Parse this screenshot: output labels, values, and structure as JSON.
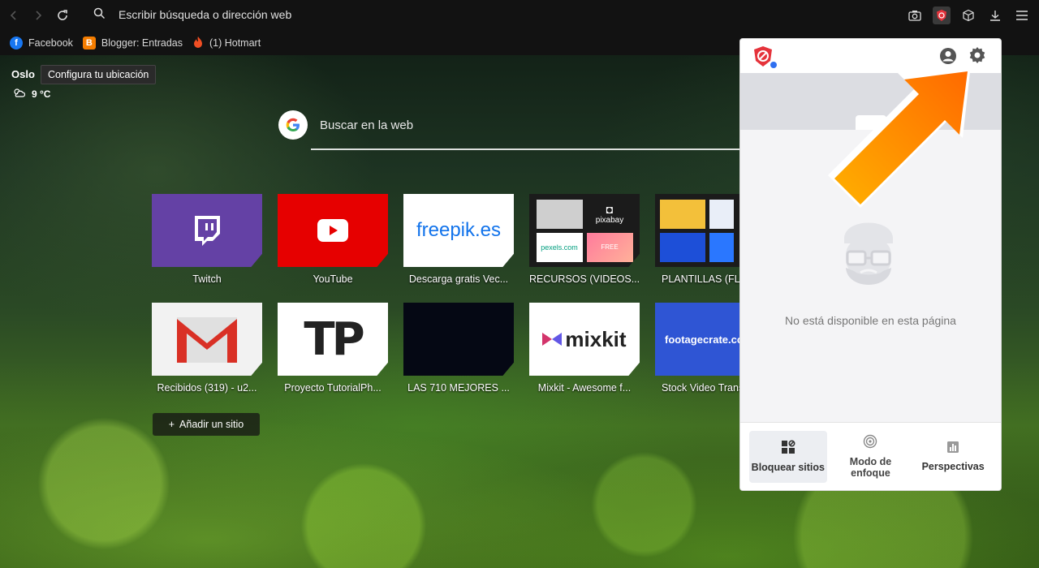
{
  "toolbar": {
    "address_placeholder": "Escribir búsqueda o dirección web",
    "icons": [
      "back-arrow-icon",
      "forward-arrow-icon",
      "reload-icon",
      "search-icon",
      "camera-icon",
      "blocksite-extension-icon",
      "cube-icon",
      "download-icon",
      "menu-icon"
    ]
  },
  "bookmarks": [
    {
      "label": "Facebook",
      "icon": "facebook-icon",
      "color": "#1877f2"
    },
    {
      "label": "Blogger: Entradas",
      "icon": "blogger-icon",
      "color": "#f57d00"
    },
    {
      "label": "(1) Hotmart",
      "icon": "hotmart-icon",
      "color": "#f04e23"
    }
  ],
  "weather": {
    "city": "Oslo",
    "tooltip": "Configura tu ubicación",
    "temperature": "9 °C"
  },
  "search": {
    "placeholder": "Buscar en la web"
  },
  "speed_dial": {
    "row1": [
      {
        "label": "Twitch",
        "bg": "#6441a5"
      },
      {
        "label": "YouTube",
        "bg": "#e60000"
      },
      {
        "label": "Descarga gratis Vec...",
        "bg": "#ffffff",
        "logo": "freepik.es"
      },
      {
        "label": "RECURSOS (VIDEOS...",
        "bg": "#1b1b1b",
        "sub": [
          "pexels.com",
          "pixabay",
          "FREE"
        ]
      },
      {
        "label": "PLANTILLAS (FLYE",
        "bg": "#1b1b1b"
      }
    ],
    "row2": [
      {
        "label": "Recibidos (319) - u2...",
        "bg": "#f2f2f2"
      },
      {
        "label": "Proyecto TutorialPh...",
        "bg": "#ffffff",
        "logo": "TP"
      },
      {
        "label": "LAS 710 MEJORES ...",
        "bg": "#050814"
      },
      {
        "label": "Mixkit - Awesome f...",
        "bg": "#ffffff",
        "logo": "mixkit"
      },
      {
        "label": "Stock Video Trans",
        "bg": "#2f55d4",
        "logo": "footagecrate.co"
      }
    ],
    "add_site": "Añadir un sitio"
  },
  "popup": {
    "unavailable": "No está disponible en esta página",
    "footer": [
      {
        "label": "Bloquear sitios",
        "icon": "block-sites-icon"
      },
      {
        "label": "Modo de enfoque",
        "icon": "focus-mode-icon"
      },
      {
        "label": "Perspectivas",
        "icon": "insights-icon"
      }
    ]
  },
  "colors": {
    "accent_arrow": "#ff8a00",
    "blocksite_red": "#e5333b"
  }
}
